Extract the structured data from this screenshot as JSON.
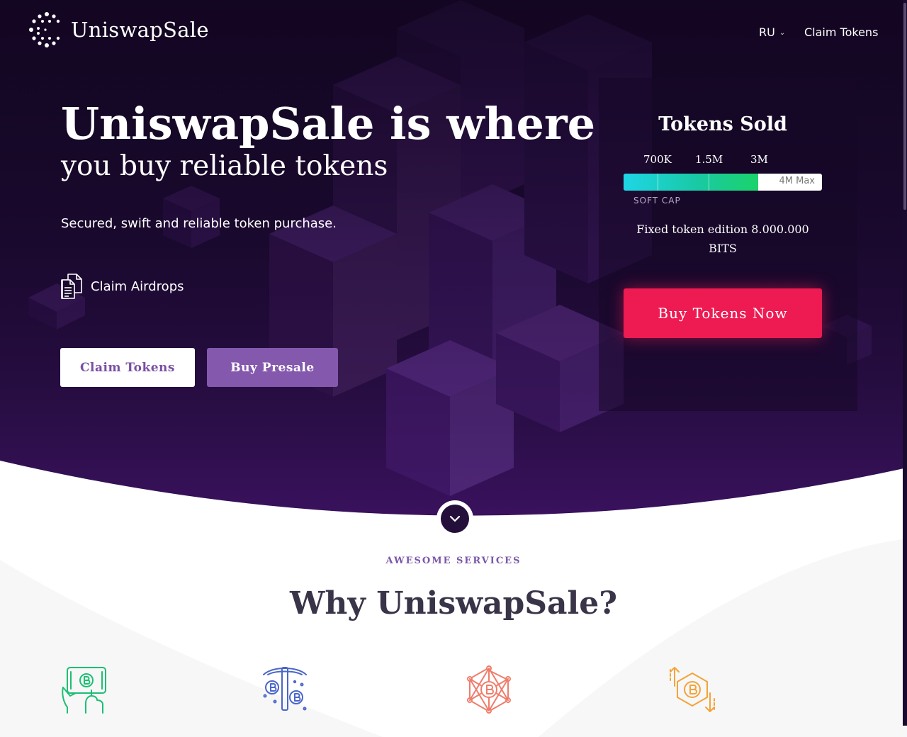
{
  "brand": {
    "name": "UniswapSale",
    "logo_icon": "dotted-c-logo-icon"
  },
  "nav": {
    "language": "RU",
    "claim_link": "Claim Tokens"
  },
  "hero": {
    "title_line1": "UniswapSale is where",
    "title_line2": "you buy reliable tokens",
    "tagline": "Secured, swift and reliable token purchase.",
    "airdrops_label": "Claim Airdrops",
    "airdrops_icon": "documents-icon",
    "btn_claim": "Claim Tokens",
    "btn_presale": "Buy Presale"
  },
  "tokens": {
    "title": "Tokens Sold",
    "ticks": [
      "700K",
      "1.5M",
      "3M"
    ],
    "progress_fraction": 0.68,
    "max_label": "4M Max",
    "soft_cap_label": "SOFT CAP",
    "edition_text": "Fixed token edition 8.000.000 BITS",
    "buy_button": "Buy Tokens Now"
  },
  "scroll_down_icon": "chevron-down-icon",
  "services": {
    "kicker": "AWESOME SERVICES",
    "title": "Why UniswapSale?",
    "icons": [
      "hand-bitcoin-card-icon",
      "bitcoin-mining-icon",
      "bitcoin-network-icon",
      "bitcoin-exchange-icon"
    ]
  },
  "colors": {
    "hero_dark": "#150826",
    "accent_purple": "#8458ad",
    "buy_red": "#ee1a52",
    "icon_green": "#1dbf73",
    "icon_blue": "#4a66c8",
    "icon_coral": "#ef7d6c",
    "icon_orange": "#f4a338"
  }
}
